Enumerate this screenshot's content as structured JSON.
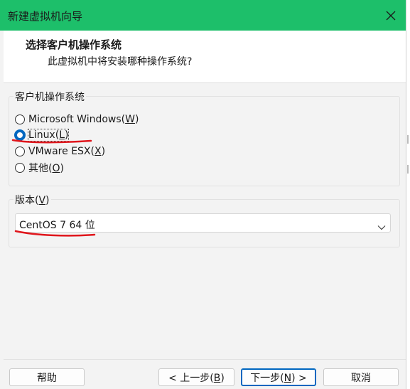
{
  "window": {
    "title": "新建虚拟机向导",
    "close_icon": "close-icon"
  },
  "header": {
    "title": "选择客户机操作系统",
    "subtitle": "此虚拟机中将安装哪种操作系统?"
  },
  "os_group": {
    "label": "客户机操作系统",
    "options": [
      {
        "text": "Microsoft Windows(",
        "key": "W",
        "close": ")",
        "checked": false
      },
      {
        "text": "Linux(",
        "key": "L",
        "close": ")",
        "checked": true
      },
      {
        "text": "VMware ESX(",
        "key": "X",
        "close": ")",
        "checked": false
      },
      {
        "text": "其他(",
        "key": "O",
        "close": ")",
        "checked": false
      }
    ]
  },
  "version_group": {
    "label_text": "版本(",
    "label_key": "V",
    "label_close": ")",
    "selected": "CentOS 7 64 位",
    "chevron_icon": "chevron-down-icon"
  },
  "buttons": {
    "help": "帮助",
    "back_text": "< 上一步(",
    "back_key": "B",
    "back_close": ")",
    "next_text": "下一步(",
    "next_key": "N",
    "next_close": ") >",
    "cancel": "取消"
  },
  "colors": {
    "titlebar": "#1dbf6a",
    "accent": "#0067c0",
    "annotation": "#e0161c"
  }
}
